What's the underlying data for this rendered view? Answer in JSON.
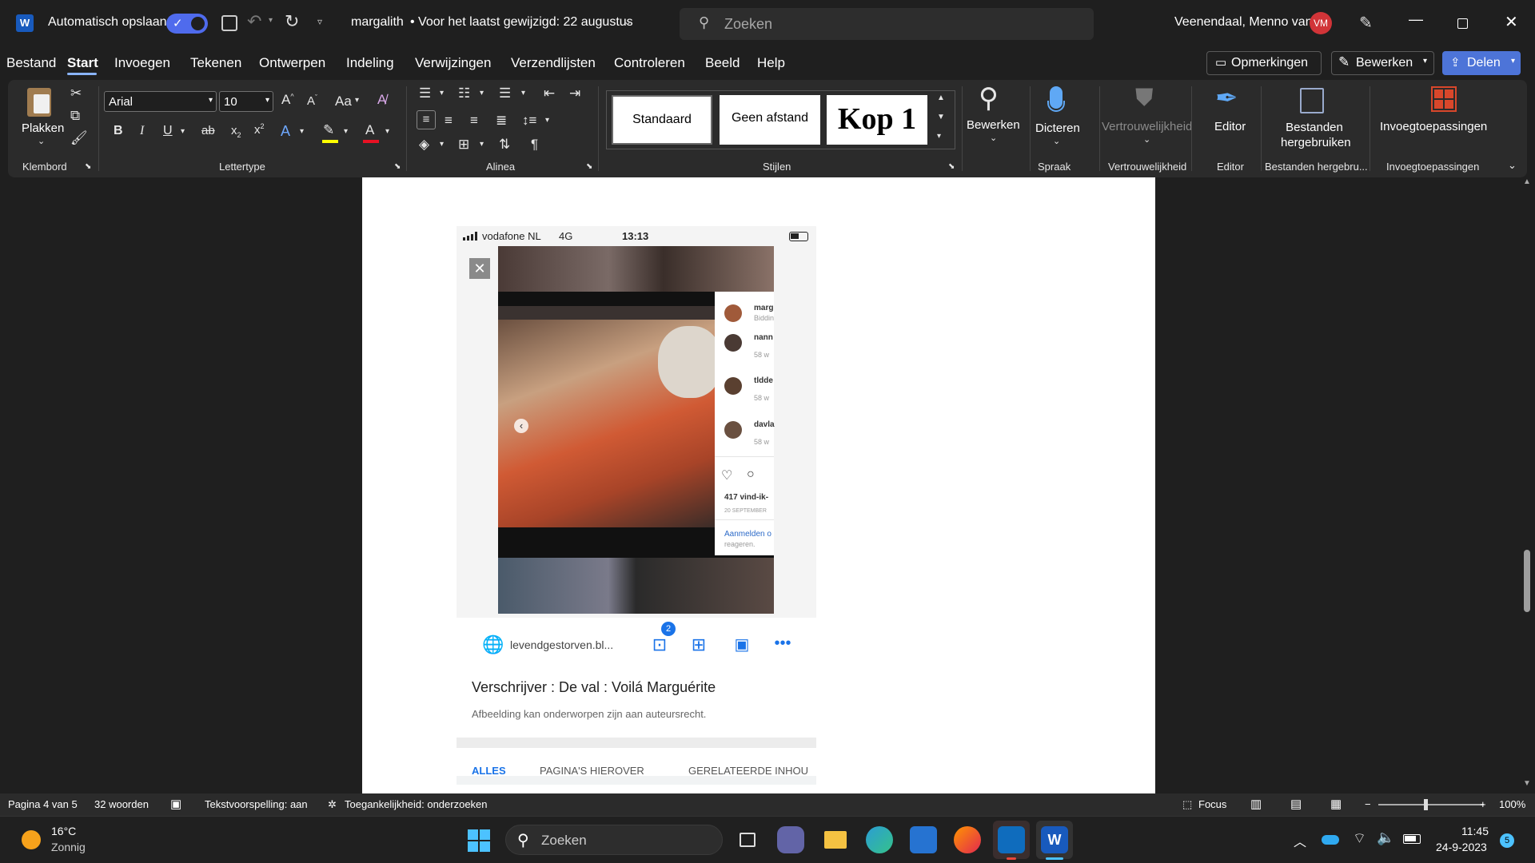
{
  "titlebar": {
    "autosave_label": "Automatisch opslaan",
    "doc_name": "margalith",
    "last_modified": "• Voor het laatst gewijzigd: 22 augustus",
    "search_placeholder": "Zoeken",
    "user_name": "Veenendaal, Menno van",
    "user_initials": "VM"
  },
  "menu": {
    "items": [
      "Bestand",
      "Start",
      "Invoegen",
      "Tekenen",
      "Ontwerpen",
      "Indeling",
      "Verwijzingen",
      "Verzendlijsten",
      "Controleren",
      "Beeld",
      "Help"
    ],
    "active": "Start",
    "comments": "Opmerkingen",
    "edit": "Bewerken",
    "share": "Delen"
  },
  "ribbon": {
    "clipboard": {
      "paste": "Plakken",
      "label": "Klembord"
    },
    "font": {
      "name": "Arial",
      "size": "10",
      "case_btn": "Aa",
      "label": "Lettertype"
    },
    "paragraph": {
      "label": "Alinea"
    },
    "styles": {
      "items": [
        "Standaard",
        "Geen afstand",
        "Kop 1"
      ],
      "label": "Stijlen"
    },
    "editing": {
      "title": "Bewerken"
    },
    "voice": {
      "title": "Dicteren",
      "label": "Spraak"
    },
    "sensitivity": {
      "title": "Vertrouwelijkheid",
      "label": "Vertrouwelijkheid"
    },
    "editor": {
      "title": "Editor",
      "label": "Editor"
    },
    "reuse": {
      "title": "Bestanden hergebruiken",
      "label": "Bestanden hergebru..."
    },
    "addins": {
      "title": "Invoegtoepassingen",
      "label": "Invoegtoepassingen"
    }
  },
  "phone": {
    "carrier": "vodafone NL",
    "network": "4G",
    "time": "13:13",
    "comments": [
      {
        "user": "marg",
        "sub": "Biddin"
      },
      {
        "user": "nann",
        "sub": "58 w"
      },
      {
        "user": "tldde",
        "sub": "58 w"
      },
      {
        "user": "davla",
        "sub": "58 w"
      }
    ],
    "likes": "417 vind-ik-",
    "date": "20 SEPTEMBER",
    "login": "Aanmelden o",
    "reply": "reageren.",
    "site": "levendgestorven.bl...",
    "badge": "2",
    "caption_title": "Verschrijver : De val : Voilá Marguérite",
    "caption_sub": "Afbeelding kan onderworpen zijn aan auteursrecht.",
    "tabs": [
      "ALLES",
      "PAGINA'S HIEROVER",
      "GERELATEERDE INHOU"
    ]
  },
  "status": {
    "page": "Pagina 4 van 5",
    "words": "32 woorden",
    "proofing": "Tekstvoorspelling: aan",
    "accessibility": "Toegankelijkheid: onderzoeken",
    "focus": "Focus",
    "zoom": "100%"
  },
  "taskbar": {
    "temp": "16°C",
    "weather": "Zonnig",
    "search": "Zoeken",
    "time": "11:45",
    "date": "24-9-2023",
    "notif": "5"
  }
}
